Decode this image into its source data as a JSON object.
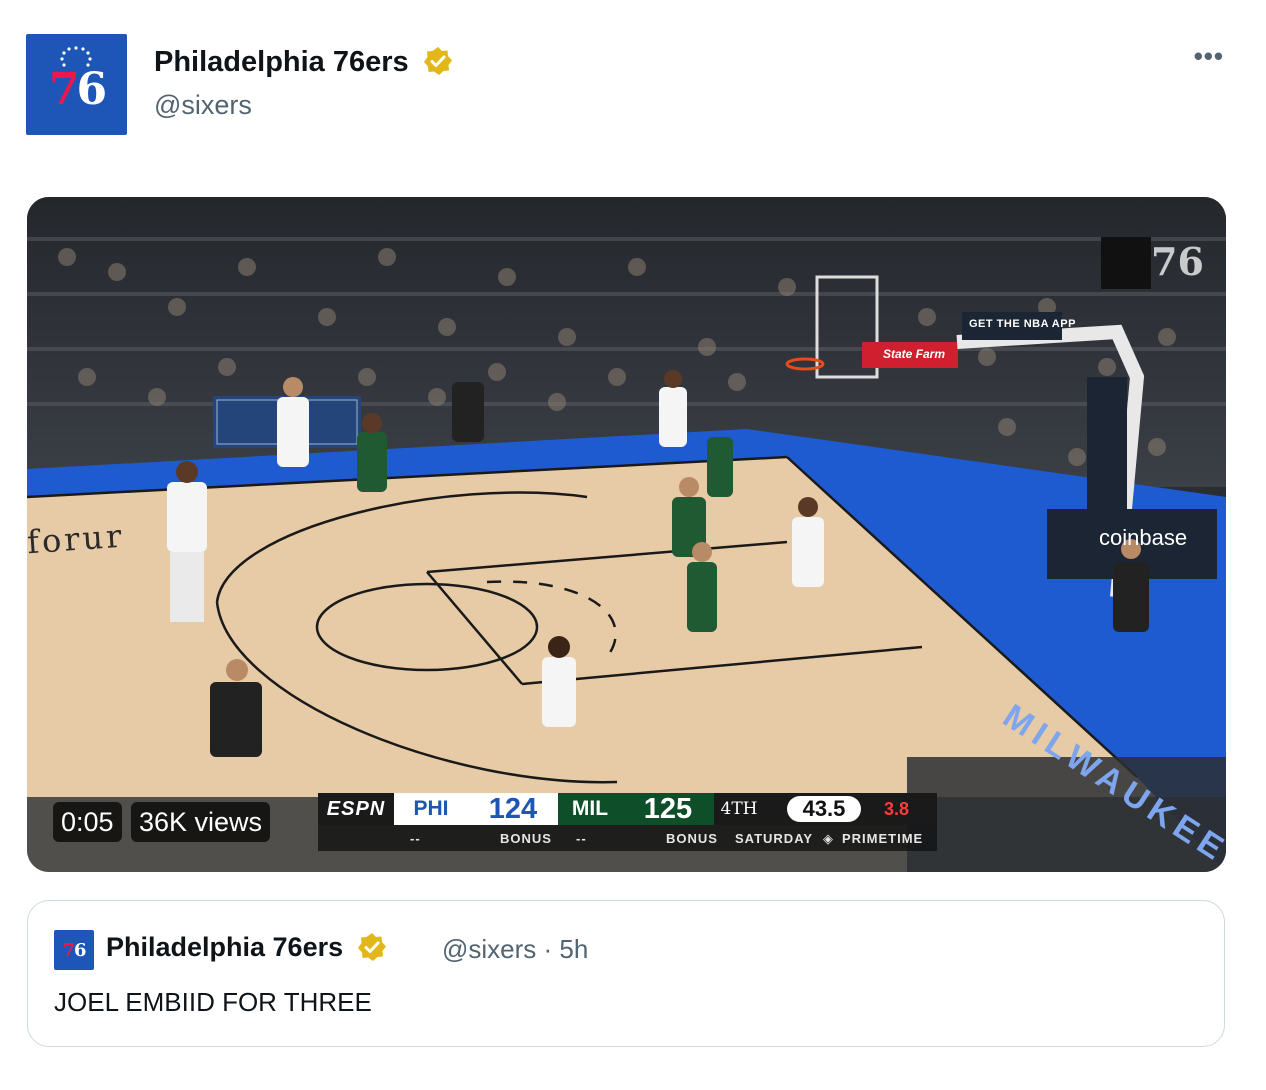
{
  "account": {
    "display_name": "Philadelphia 76ers",
    "handle": "@sixers",
    "logo_text": "76",
    "more_label": "•••"
  },
  "video": {
    "elapsed": "0:05",
    "views": "36K views",
    "scorebug": {
      "network": "ESPN",
      "home_abbr": "PHI",
      "home_score": "124",
      "away_abbr": "MIL",
      "away_score": "125",
      "quarter": "4TH",
      "clock": "43.5",
      "shot_clock": "3.8",
      "home_bonus_dash": "--",
      "home_bonus": "BONUS",
      "away_bonus_dash": "--",
      "away_bonus": "BONUS",
      "program": "SATURDAY",
      "program_suffix": "PRIMETIME"
    },
    "arena_text": {
      "sponsor_coinbase": "coinbase",
      "sponsor_statefarm": "State Farm",
      "get_app": "GET THE NBA APP",
      "watermark": "76",
      "court_left": "forur",
      "court_right": "MILWAUKEE"
    }
  },
  "quoted_post": {
    "display_name": "Philadelphia 76ers",
    "meta": "@sixers · 5h",
    "text": "JOEL EMBIID FOR THREE",
    "logo_text": "76"
  },
  "colors": {
    "brand_blue": "#1d56b7",
    "brand_red": "#ed174c",
    "verified_gold": "#e2b719",
    "bucks_green": "#0e4f2a"
  }
}
